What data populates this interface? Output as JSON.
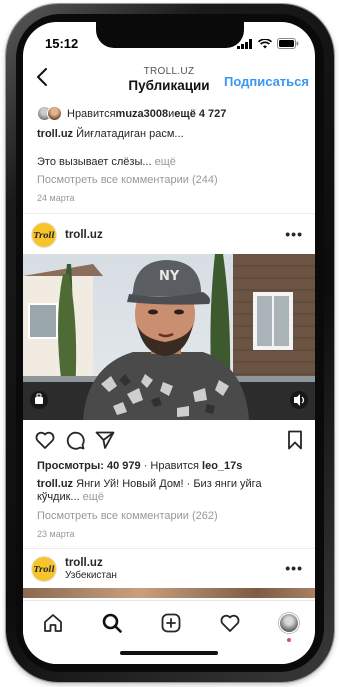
{
  "status_bar": {
    "time": "15:12"
  },
  "header": {
    "account": "TROLL.UZ",
    "title": "Публикации",
    "subscribe_label": "Подписаться"
  },
  "previous_post": {
    "likes_prefix": "Нравится ",
    "likes_user": "muza3008",
    "likes_middle": " и ",
    "likes_more": "ещё 4 727",
    "caption_user": "troll.uz",
    "caption_text": " Йиғлатадиган расм...",
    "caption2_text": "Это вызывает слёзы...",
    "caption2_more": " ещё",
    "view_comments": "Посмотреть все комментарии (244)",
    "date": "24 марта"
  },
  "post": {
    "username": "troll.uz",
    "logo_text": "Troll",
    "more_label": "•••",
    "views_prefix": "Просмотры: ",
    "views_count": "40 979",
    "views_sep": " · Нравится ",
    "liked_by": "leo_17s",
    "caption_user": "troll.uz",
    "caption_text": " Янги Уй! Новый Дом! · Биз янги уйга кўчдик...",
    "caption_more": " ещё",
    "view_comments": "Посмотреть все комментарии (262)",
    "date": "23 марта",
    "cap_text": "NY"
  },
  "next_post": {
    "username": "troll.uz",
    "logo_text": "Troll",
    "location": "Узбекистан",
    "more_label": "•••"
  },
  "tabs": [
    "home",
    "search",
    "new-post",
    "activity",
    "profile"
  ],
  "colors": {
    "accent": "#3897f0",
    "muted": "#999999",
    "logo_yellow": "#f7c52b",
    "notification": "#ed4956"
  }
}
